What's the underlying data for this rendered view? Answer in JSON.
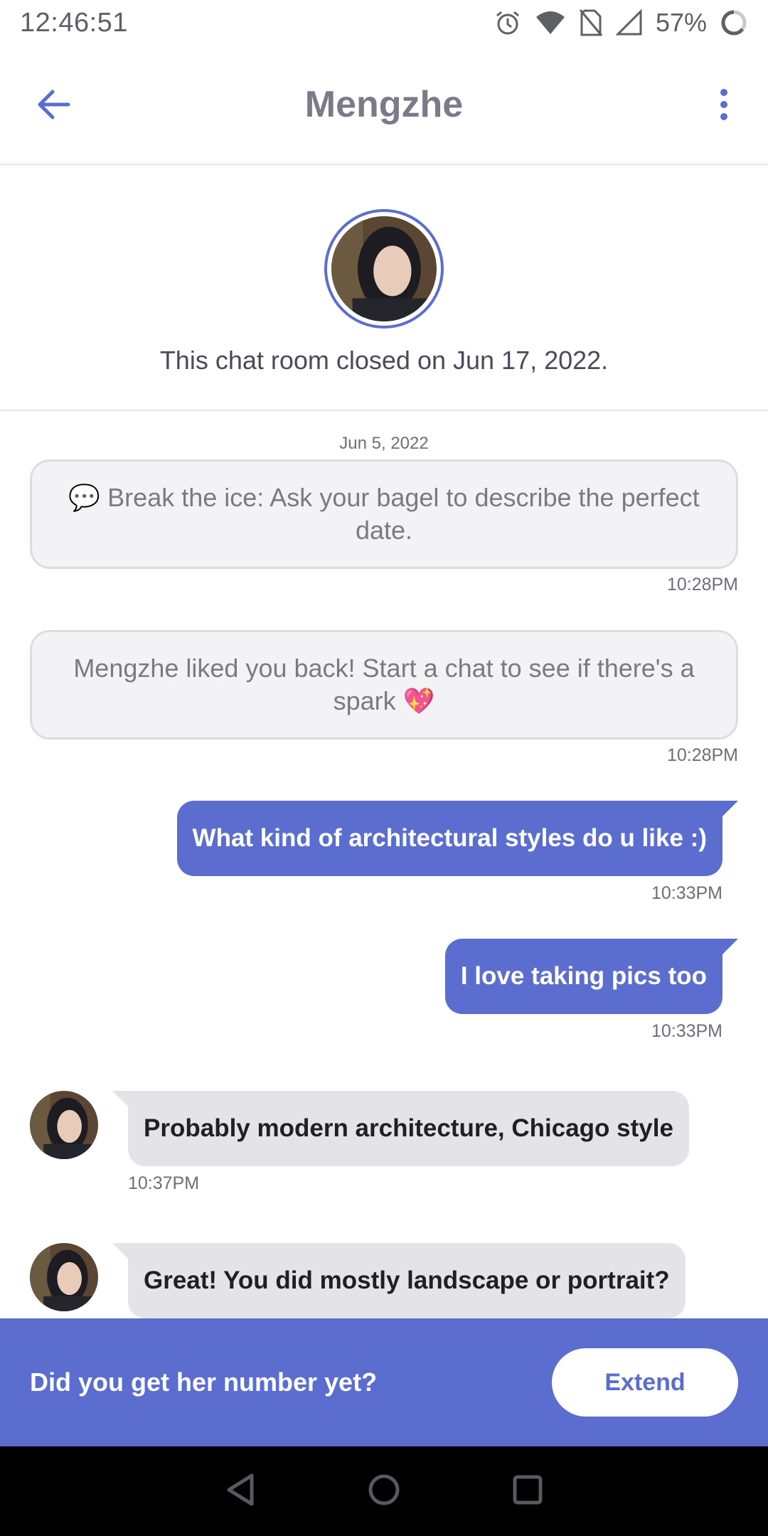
{
  "status_bar": {
    "time": "12:46:51",
    "battery_percent": "57%",
    "icons": [
      "alarm-icon",
      "wifi-icon",
      "no-sim-icon",
      "signal-icon",
      "battery-ring-icon"
    ]
  },
  "header": {
    "title": "Mengzhe",
    "back_icon": "arrow-left-icon",
    "menu_icon": "more-vertical-icon"
  },
  "closed_notice": {
    "text": "This chat room closed on Jun 17, 2022."
  },
  "chat": {
    "date": "Jun 5, 2022",
    "system_messages": [
      {
        "text": "💬 Break the ice: Ask your bagel to describe the perfect date.",
        "time": "10:28PM"
      },
      {
        "text": "Mengzhe liked you back! Start a chat to see if there's a spark 💖",
        "time": "10:28PM"
      }
    ],
    "outgoing": [
      {
        "text": "What kind of architectural styles do u like :)",
        "time": "10:33PM"
      },
      {
        "text": "I love taking pics too",
        "time": "10:33PM"
      }
    ],
    "incoming": [
      {
        "text": "Probably modern architecture, Chicago style",
        "time": "10:37PM"
      },
      {
        "text": "Great! You did mostly landscape or portrait?"
      }
    ]
  },
  "banner": {
    "prompt": "Did you get her number yet?",
    "button": "Extend"
  },
  "navbar": {
    "icons": [
      "back-triangle-icon",
      "home-circle-icon",
      "recents-square-icon"
    ]
  },
  "colors": {
    "accent": "#5b6ecf",
    "incoming_bubble": "#e4e4e8",
    "system_bubble": "#f3f3f5"
  }
}
